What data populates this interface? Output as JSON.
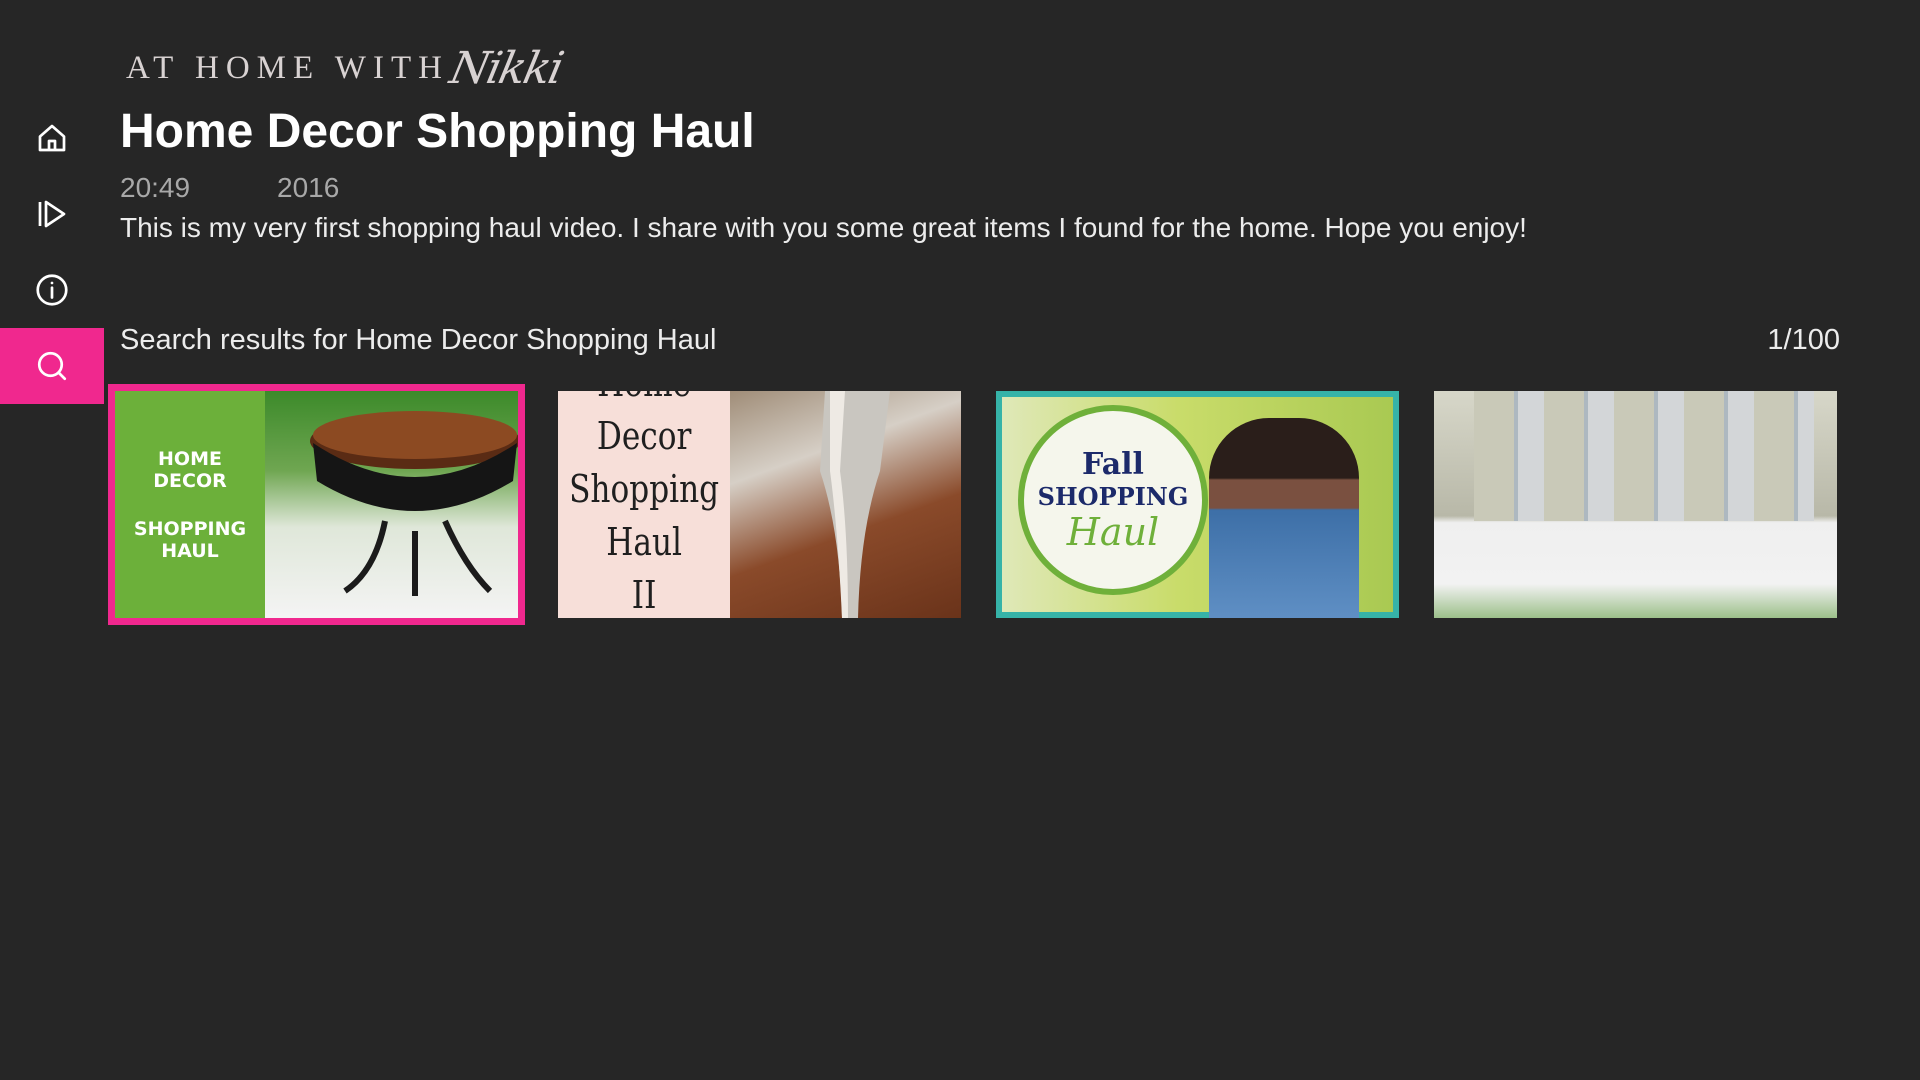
{
  "brand": {
    "main": "AT HOME WITH",
    "script": "Nikki"
  },
  "sidebar": {
    "items": [
      {
        "name": "home",
        "icon": "home-icon",
        "active": false
      },
      {
        "name": "play",
        "icon": "play-icon",
        "active": false
      },
      {
        "name": "info",
        "icon": "info-icon",
        "active": false
      },
      {
        "name": "search",
        "icon": "search-icon",
        "active": true
      }
    ],
    "active_color": "#f0288e"
  },
  "video": {
    "title": "Home Decor Shopping Haul",
    "duration": "20:49",
    "year": "2016",
    "description": "This is my very first shopping haul video. I share with you some great items I found for the home. Hope you enjoy!"
  },
  "results": {
    "label": "Search results for Home Decor Shopping Haul",
    "count": "1/100",
    "thumbnails": [
      {
        "line1": "HOME",
        "line2": "DECOR",
        "line3": "SHOPPING",
        "line4": "HAUL"
      },
      {
        "line1": "Home",
        "line2": "Decor",
        "line3": "Shopping",
        "line4": "Haul",
        "line5": "II"
      },
      {
        "line1": "Fall",
        "line2": "SHOPPING",
        "line3": "Haul"
      },
      {}
    ]
  },
  "colors": {
    "background": "#262626",
    "accent": "#f0288e"
  }
}
